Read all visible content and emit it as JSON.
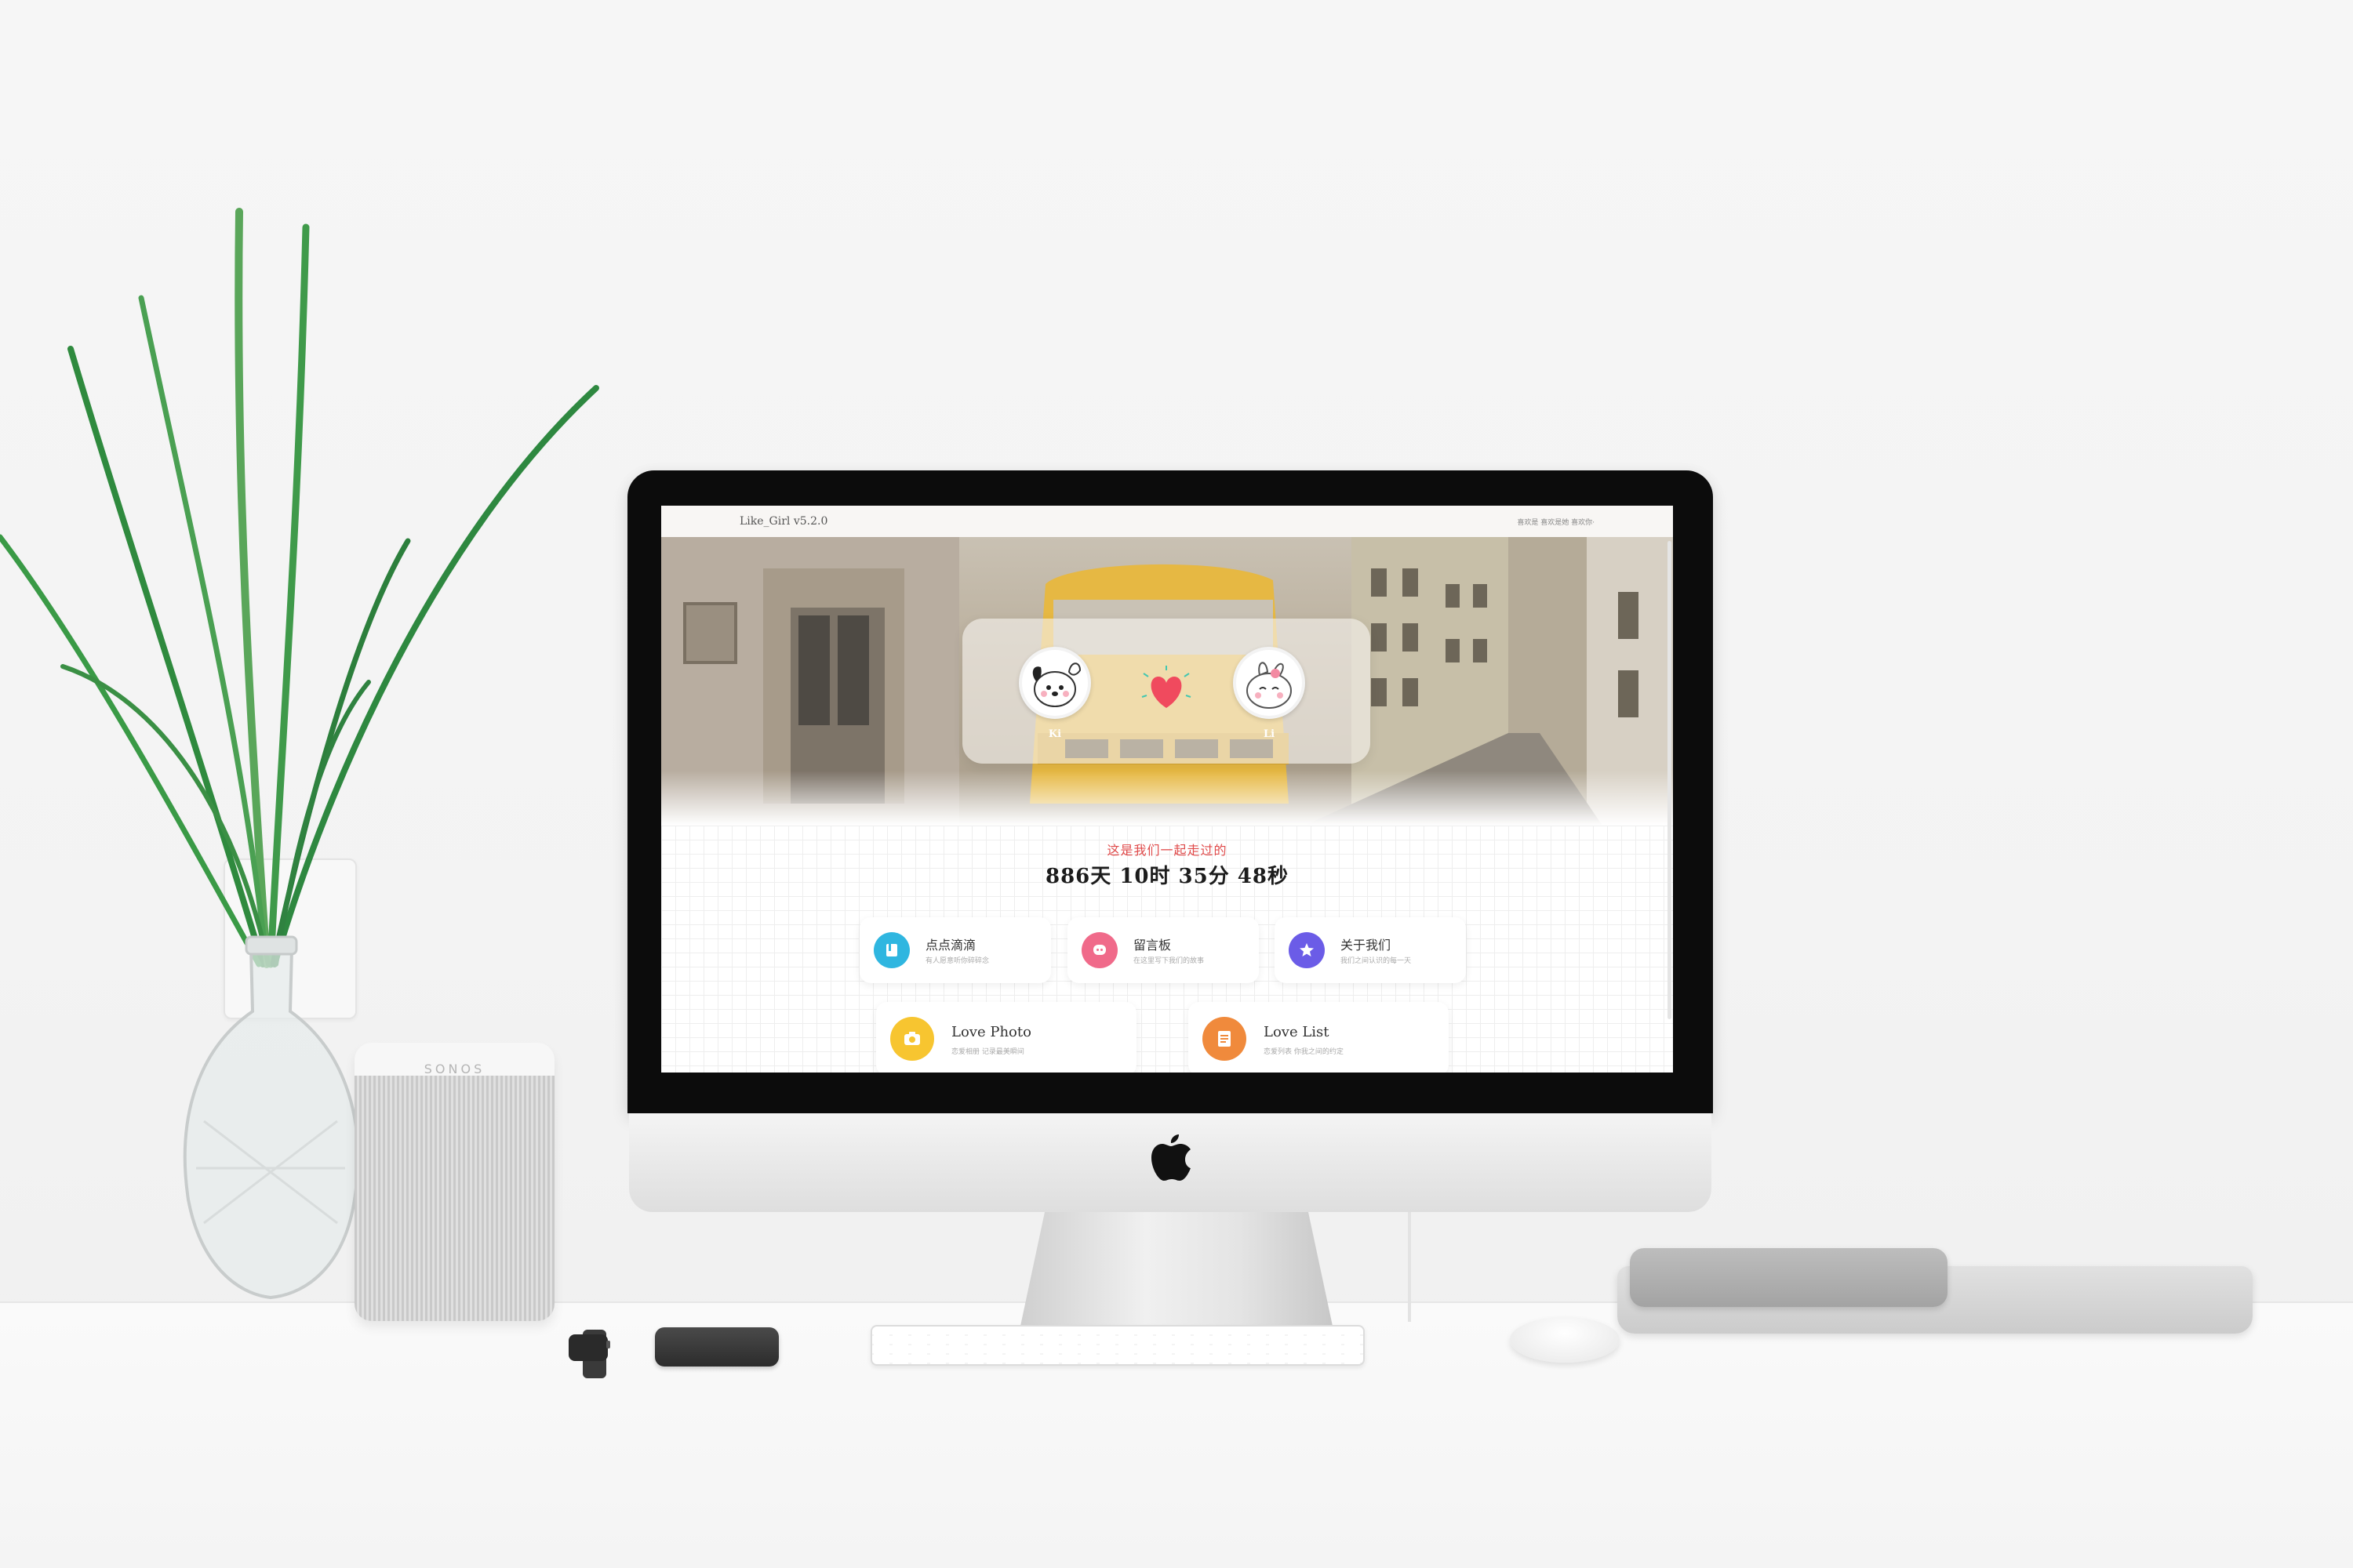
{
  "speaker": {
    "logo": "SONOS"
  },
  "site": {
    "brand": "Like_Girl v5.2.0",
    "topnav": "喜欢是 喜欢是她 喜欢你·"
  },
  "couple": {
    "left_name": "Ki",
    "right_name": "Li"
  },
  "counter": {
    "label": "这是我们一起走过的",
    "time": "886天 10时 35分 48秒"
  },
  "cards": [
    {
      "title": "点点滴滴",
      "subtitle": "有人愿意听你碎碎念",
      "color": "#2fb6e0",
      "icon": "book-icon"
    },
    {
      "title": "留言板",
      "subtitle": "在这里写下我们的故事",
      "color": "#f06a8a",
      "icon": "chat-icon"
    },
    {
      "title": "关于我们",
      "subtitle": "我们之间认识的每一天",
      "color": "#6b5ce7",
      "icon": "star-icon"
    },
    {
      "title": "Love Photo",
      "subtitle": "恋爱相册 记录最美瞬间",
      "color": "#f7c530",
      "icon": "camera-icon"
    },
    {
      "title": "Love List",
      "subtitle": "恋爱列表 你我之间的约定",
      "color": "#f08a3c",
      "icon": "list-icon"
    }
  ],
  "colors": {
    "accent_red": "#e04a4a",
    "heart": "#f04a5e",
    "plant_green": "#3aa34a"
  }
}
